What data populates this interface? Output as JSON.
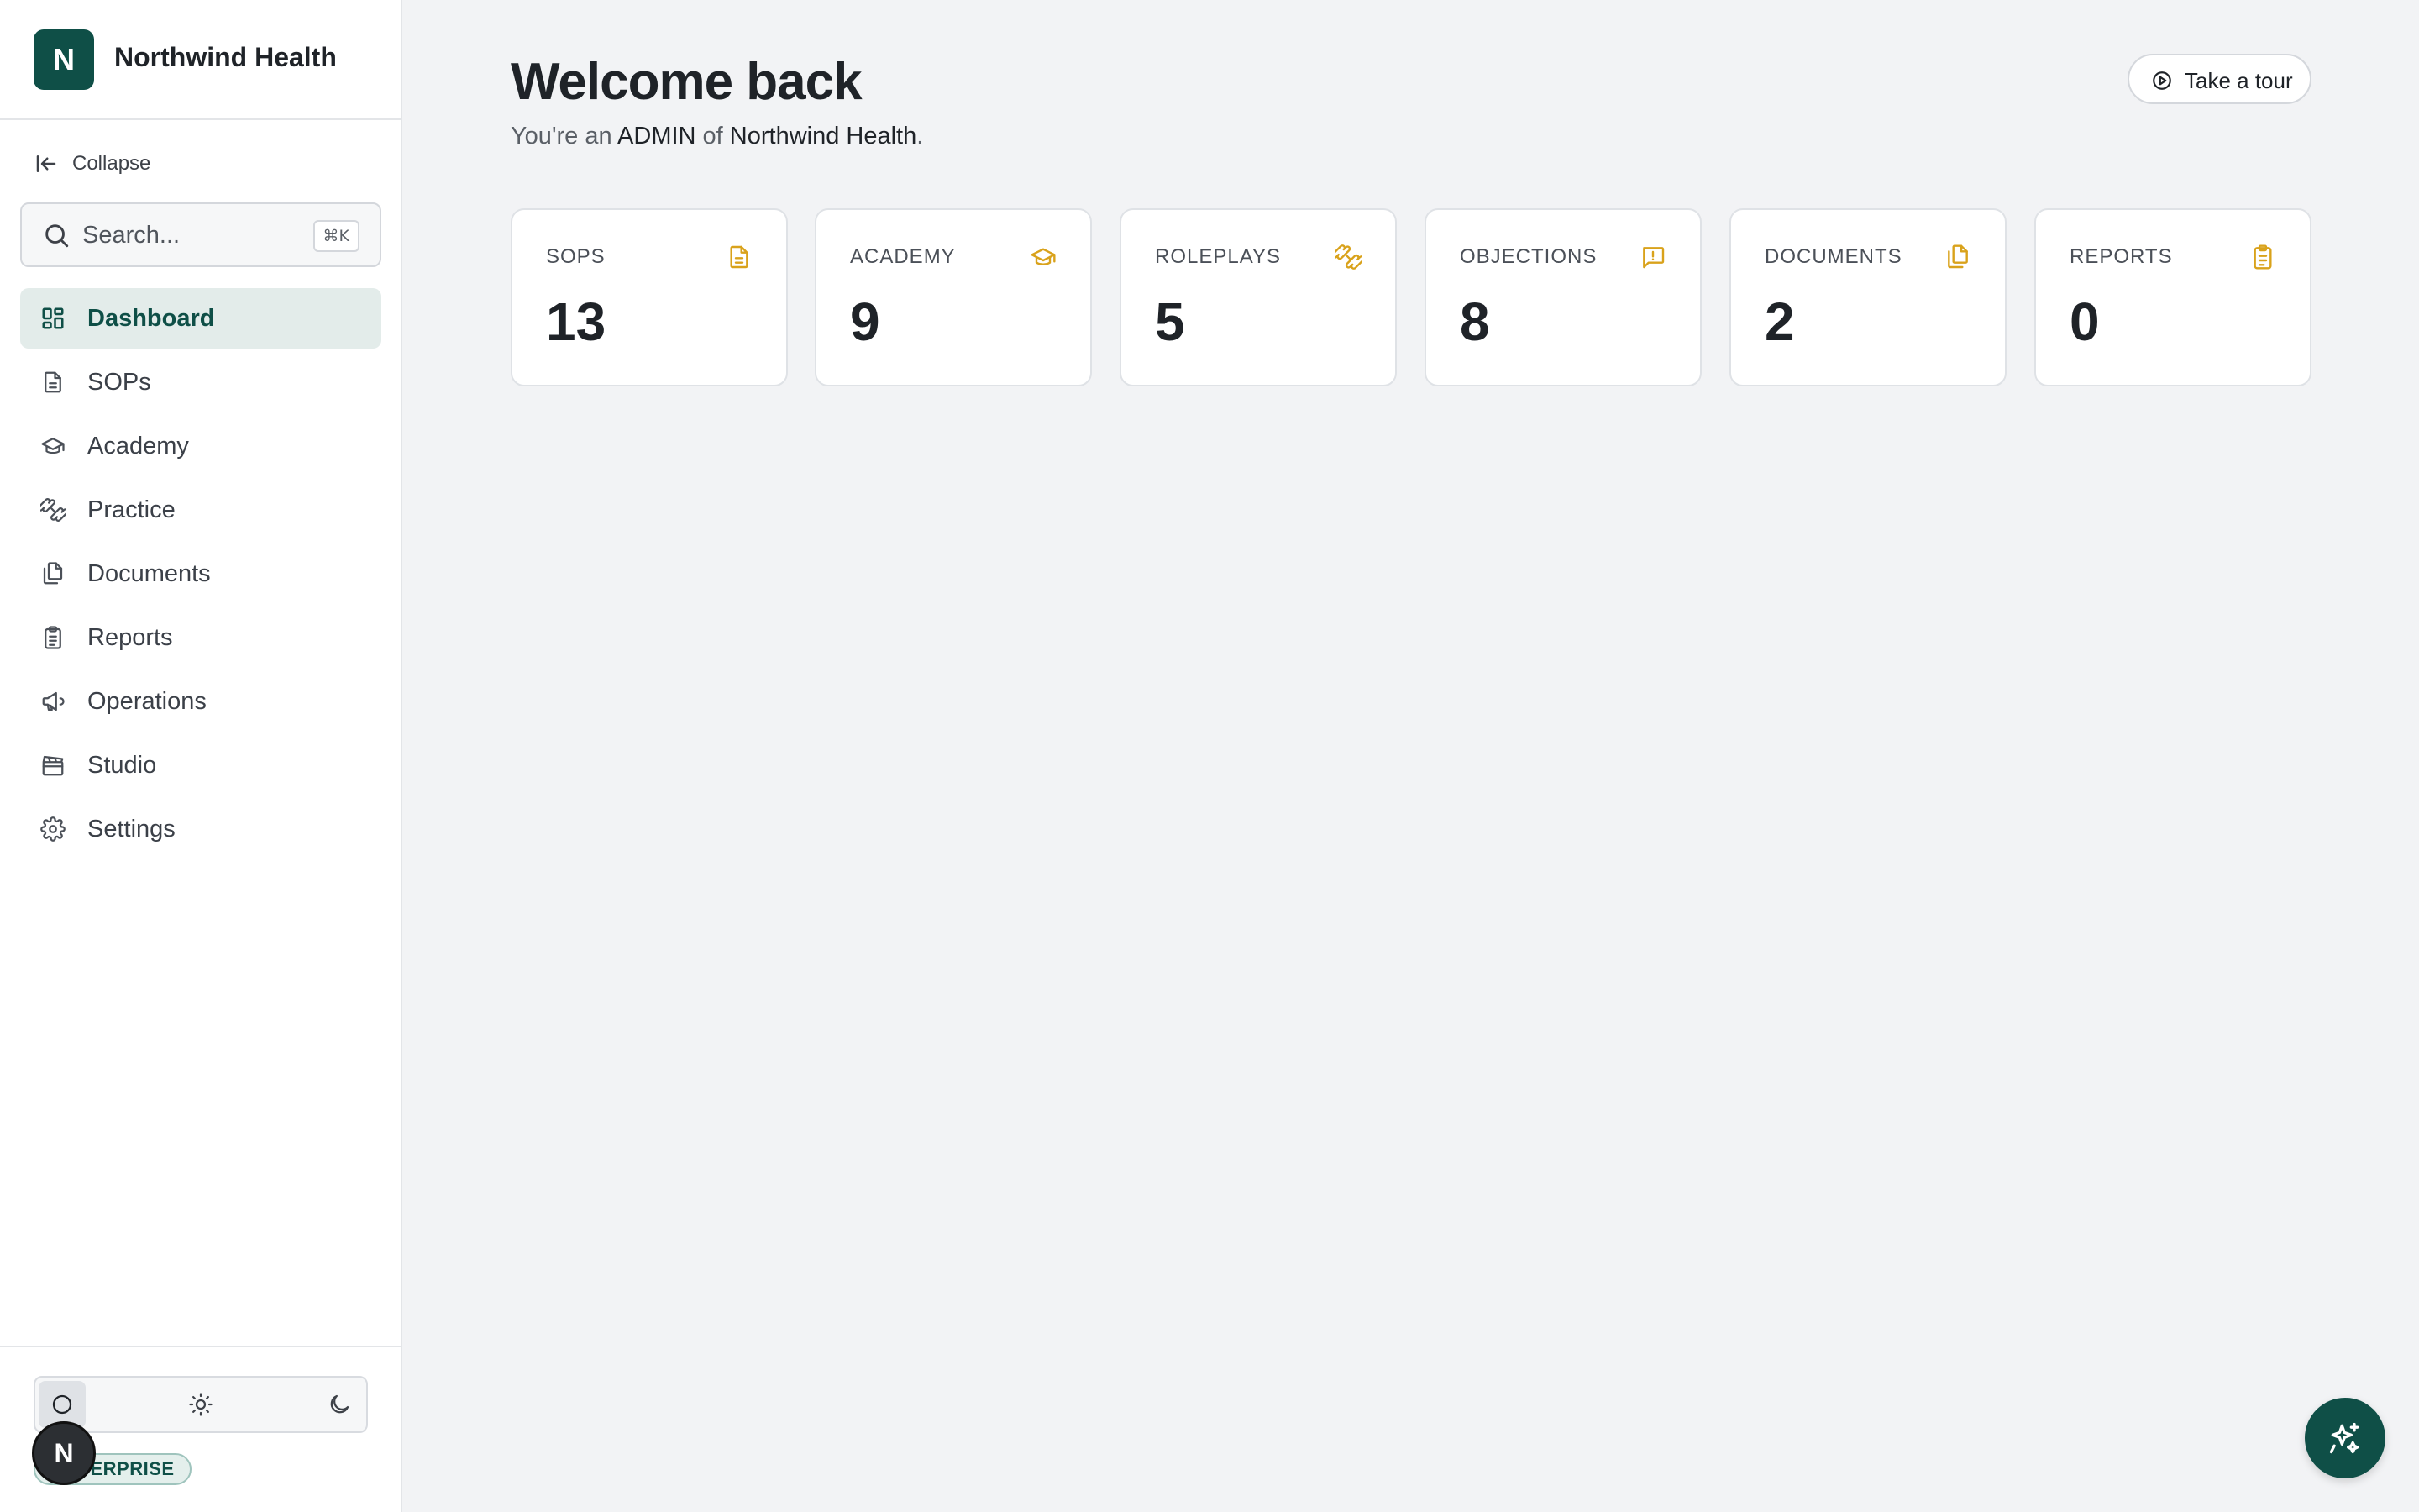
{
  "brand": {
    "logo_letter": "N",
    "name": "Northwind Health"
  },
  "sidebar": {
    "collapse_label": "Collapse",
    "search": {
      "placeholder": "Search...",
      "shortcut": "⌘K"
    },
    "items": [
      {
        "label": "Dashboard",
        "icon": "dashboard-icon",
        "active": true
      },
      {
        "label": "SOPs",
        "icon": "file-text-icon"
      },
      {
        "label": "Academy",
        "icon": "graduation-cap-icon"
      },
      {
        "label": "Practice",
        "icon": "dumbbell-icon"
      },
      {
        "label": "Documents",
        "icon": "documents-icon"
      },
      {
        "label": "Reports",
        "icon": "clipboard-icon"
      },
      {
        "label": "Operations",
        "icon": "megaphone-icon"
      },
      {
        "label": "Studio",
        "icon": "clapperboard-icon"
      },
      {
        "label": "Settings",
        "icon": "gear-icon"
      }
    ],
    "theme_options": [
      "system",
      "light",
      "dark"
    ],
    "theme_selected": "system",
    "avatar_letter": "N",
    "plan_badge": "ENTERPRISE"
  },
  "main": {
    "title": "Welcome back",
    "subtitle": {
      "prefix": "You're an ",
      "role": "ADMIN",
      "middle": " of ",
      "org": "Northwind Health",
      "suffix": "."
    },
    "tour_button": "Take a tour",
    "stats": [
      {
        "label": "SOPS",
        "value": "13",
        "icon": "file-text-icon"
      },
      {
        "label": "ACADEMY",
        "value": "9",
        "icon": "graduation-cap-icon"
      },
      {
        "label": "ROLEPLAYS",
        "value": "5",
        "icon": "dumbbell-icon"
      },
      {
        "label": "OBJECTIONS",
        "value": "8",
        "icon": "message-alert-icon"
      },
      {
        "label": "DOCUMENTS",
        "value": "2",
        "icon": "documents-icon"
      },
      {
        "label": "REPORTS",
        "value": "0",
        "icon": "clipboard-icon"
      }
    ]
  },
  "colors": {
    "accent": "#0f4f47",
    "stat_icon": "#d9a21b",
    "background": "#f2f3f5"
  }
}
